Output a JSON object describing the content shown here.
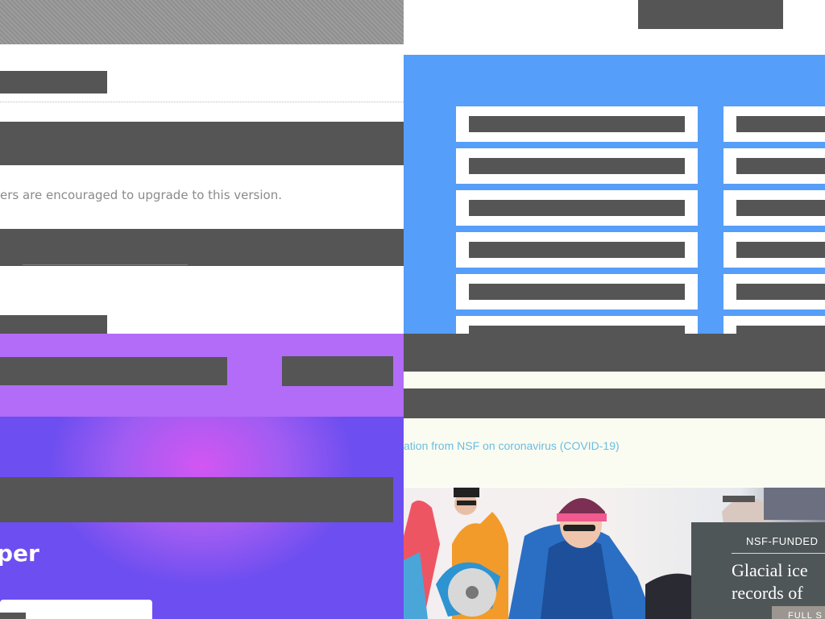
{
  "top_left": {
    "notice_text": "ers are encouraged to upgrade to this version."
  },
  "bottom_left": {
    "hero_title_partial": "per"
  },
  "bottom_right": {
    "covid_link": "ation from NSF on coronavirus (COVID-19)",
    "feature": {
      "label": "NSF-FUNDED",
      "headline_line1": "Glacial ice",
      "headline_line2": "records of",
      "button_label": "FULL S"
    }
  },
  "colors": {
    "dark_placeholder": "#555555",
    "blue_panel": "#559ef9",
    "purple_band": "#b26cf8",
    "link_blue": "#69bde2",
    "overlay_gray": "#4f5657"
  }
}
